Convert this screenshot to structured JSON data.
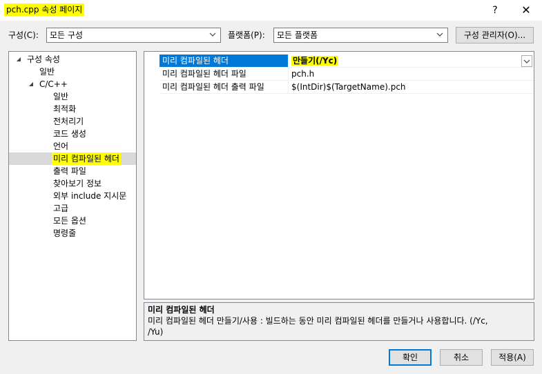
{
  "window": {
    "title": "pch.cpp 속성 페이지",
    "help": "?",
    "close": "✕"
  },
  "config_bar": {
    "config_label": "구성(C):",
    "config_value": "모든 구성",
    "platform_label": "플랫폼(P):",
    "platform_value": "모든 플랫폼",
    "config_manager_button": "구성 관리자(O)..."
  },
  "tree": {
    "root": "구성 속성",
    "general": "일반",
    "cpp": "C/C++",
    "children": [
      "일반",
      "최적화",
      "전처리기",
      "코드 생성",
      "언어",
      "미리 컴파일된 헤더",
      "출력 파일",
      "찾아보기 정보",
      "외부 include 지시문",
      "고급",
      "모든 옵션",
      "명령줄"
    ],
    "selected_index": 5
  },
  "properties": [
    {
      "name": "미리 컴파일된 헤더",
      "value": "만들기(/Yc)",
      "selected": true
    },
    {
      "name": "미리 컴파일된 헤더 파일",
      "value": "pch.h"
    },
    {
      "name": "미리 컴파일된 헤더 출력 파일",
      "value": "$(IntDir)$(TargetName).pch"
    }
  ],
  "description": {
    "title": "미리 컴파일된 헤더",
    "text_line1": "미리 컴파일된 헤더 만들기/사용 : 빌드하는 동안 미리 컴파일된 헤더를 만들거나 사용합니다.     (/Yc,",
    "text_line2": "/Yu)"
  },
  "footer": {
    "ok": "확인",
    "cancel": "취소",
    "apply": "적용(A)"
  },
  "colors": {
    "highlight": "#ffff00",
    "selection_blue": "#0078d7"
  }
}
